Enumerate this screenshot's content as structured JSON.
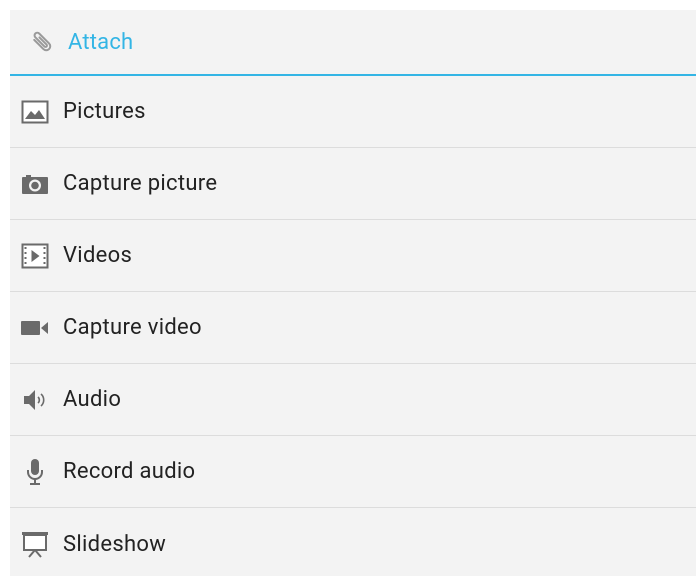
{
  "dialog": {
    "title": "Attach",
    "title_icon": "paperclip-icon",
    "accent_color": "#33b5e5",
    "background_color": "#f3f3f3",
    "items": [
      {
        "label": "Pictures",
        "icon": "pictures-icon"
      },
      {
        "label": "Capture picture",
        "icon": "camera-icon"
      },
      {
        "label": "Videos",
        "icon": "videos-icon"
      },
      {
        "label": "Capture video",
        "icon": "video-camera-icon"
      },
      {
        "label": "Audio",
        "icon": "audio-speaker-icon"
      },
      {
        "label": "Record audio",
        "icon": "microphone-icon"
      },
      {
        "label": "Slideshow",
        "icon": "slideshow-icon"
      }
    ]
  }
}
